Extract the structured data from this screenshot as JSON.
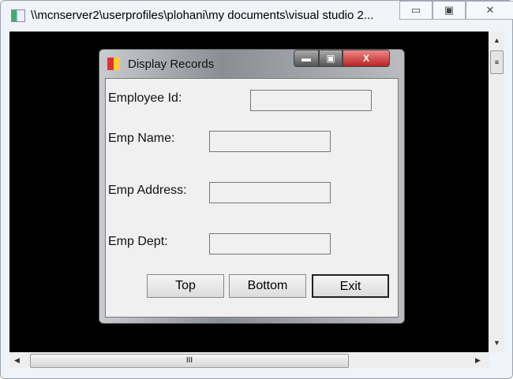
{
  "window": {
    "title": "\\\\mcnserver2\\userprofiles\\plohani\\my documents\\visual studio 2...",
    "minimize": "▭",
    "maximize": "▣",
    "close": "✕"
  },
  "dialog": {
    "title": "Display Records",
    "minimize": "▬",
    "maximize": "▣",
    "close": "X",
    "fields": [
      {
        "label": "Employee Id:",
        "value": ""
      },
      {
        "label": "Emp Name:",
        "value": ""
      },
      {
        "label": "Emp Address:",
        "value": ""
      },
      {
        "label": "Emp Dept:",
        "value": ""
      }
    ],
    "buttons": {
      "top": "Top",
      "bottom": "Bottom",
      "exit": "Exit"
    }
  },
  "scroll": {
    "grip": "III",
    "vgrip": "≡"
  }
}
